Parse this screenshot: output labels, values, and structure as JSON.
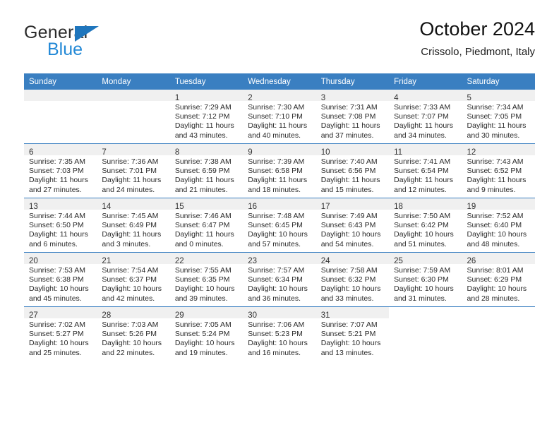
{
  "brand": {
    "name_top": "General",
    "name_bottom": "Blue",
    "accent_color": "#2288d6",
    "triangle_color": "#1f76bd"
  },
  "header": {
    "title": "October 2024",
    "subtitle": "Crissolo, Piedmont, Italy"
  },
  "theme": {
    "header_blue": "#3a7fc1",
    "daynum_band": "#f0f0f0",
    "text": "#2a2a2a"
  },
  "weekday_headers": [
    "Sunday",
    "Monday",
    "Tuesday",
    "Wednesday",
    "Thursday",
    "Friday",
    "Saturday"
  ],
  "labels": {
    "sunrise_prefix": "Sunrise:",
    "sunset_prefix": "Sunset:",
    "daylight_prefix": "Daylight:"
  },
  "weeks": [
    [
      {
        "day": "",
        "empty": true,
        "blank_band": false,
        "line1": "",
        "line2": "",
        "line3": "",
        "line4": ""
      },
      {
        "day": "",
        "empty": true,
        "blank_band": false,
        "line1": "",
        "line2": "",
        "line3": "",
        "line4": ""
      },
      {
        "day": "1",
        "line1": "Sunrise: 7:29 AM",
        "line2": "Sunset: 7:12 PM",
        "line3": "Daylight: 11 hours",
        "line4": "and 43 minutes."
      },
      {
        "day": "2",
        "line1": "Sunrise: 7:30 AM",
        "line2": "Sunset: 7:10 PM",
        "line3": "Daylight: 11 hours",
        "line4": "and 40 minutes."
      },
      {
        "day": "3",
        "line1": "Sunrise: 7:31 AM",
        "line2": "Sunset: 7:08 PM",
        "line3": "Daylight: 11 hours",
        "line4": "and 37 minutes."
      },
      {
        "day": "4",
        "line1": "Sunrise: 7:33 AM",
        "line2": "Sunset: 7:07 PM",
        "line3": "Daylight: 11 hours",
        "line4": "and 34 minutes."
      },
      {
        "day": "5",
        "line1": "Sunrise: 7:34 AM",
        "line2": "Sunset: 7:05 PM",
        "line3": "Daylight: 11 hours",
        "line4": "and 30 minutes."
      }
    ],
    [
      {
        "day": "6",
        "line1": "Sunrise: 7:35 AM",
        "line2": "Sunset: 7:03 PM",
        "line3": "Daylight: 11 hours",
        "line4": "and 27 minutes."
      },
      {
        "day": "7",
        "line1": "Sunrise: 7:36 AM",
        "line2": "Sunset: 7:01 PM",
        "line3": "Daylight: 11 hours",
        "line4": "and 24 minutes."
      },
      {
        "day": "8",
        "line1": "Sunrise: 7:38 AM",
        "line2": "Sunset: 6:59 PM",
        "line3": "Daylight: 11 hours",
        "line4": "and 21 minutes."
      },
      {
        "day": "9",
        "line1": "Sunrise: 7:39 AM",
        "line2": "Sunset: 6:58 PM",
        "line3": "Daylight: 11 hours",
        "line4": "and 18 minutes."
      },
      {
        "day": "10",
        "line1": "Sunrise: 7:40 AM",
        "line2": "Sunset: 6:56 PM",
        "line3": "Daylight: 11 hours",
        "line4": "and 15 minutes."
      },
      {
        "day": "11",
        "line1": "Sunrise: 7:41 AM",
        "line2": "Sunset: 6:54 PM",
        "line3": "Daylight: 11 hours",
        "line4": "and 12 minutes."
      },
      {
        "day": "12",
        "line1": "Sunrise: 7:43 AM",
        "line2": "Sunset: 6:52 PM",
        "line3": "Daylight: 11 hours",
        "line4": "and 9 minutes."
      }
    ],
    [
      {
        "day": "13",
        "line1": "Sunrise: 7:44 AM",
        "line2": "Sunset: 6:50 PM",
        "line3": "Daylight: 11 hours",
        "line4": "and 6 minutes."
      },
      {
        "day": "14",
        "line1": "Sunrise: 7:45 AM",
        "line2": "Sunset: 6:49 PM",
        "line3": "Daylight: 11 hours",
        "line4": "and 3 minutes."
      },
      {
        "day": "15",
        "line1": "Sunrise: 7:46 AM",
        "line2": "Sunset: 6:47 PM",
        "line3": "Daylight: 11 hours",
        "line4": "and 0 minutes."
      },
      {
        "day": "16",
        "line1": "Sunrise: 7:48 AM",
        "line2": "Sunset: 6:45 PM",
        "line3": "Daylight: 10 hours",
        "line4": "and 57 minutes."
      },
      {
        "day": "17",
        "line1": "Sunrise: 7:49 AM",
        "line2": "Sunset: 6:43 PM",
        "line3": "Daylight: 10 hours",
        "line4": "and 54 minutes."
      },
      {
        "day": "18",
        "line1": "Sunrise: 7:50 AM",
        "line2": "Sunset: 6:42 PM",
        "line3": "Daylight: 10 hours",
        "line4": "and 51 minutes."
      },
      {
        "day": "19",
        "line1": "Sunrise: 7:52 AM",
        "line2": "Sunset: 6:40 PM",
        "line3": "Daylight: 10 hours",
        "line4": "and 48 minutes."
      }
    ],
    [
      {
        "day": "20",
        "line1": "Sunrise: 7:53 AM",
        "line2": "Sunset: 6:38 PM",
        "line3": "Daylight: 10 hours",
        "line4": "and 45 minutes."
      },
      {
        "day": "21",
        "line1": "Sunrise: 7:54 AM",
        "line2": "Sunset: 6:37 PM",
        "line3": "Daylight: 10 hours",
        "line4": "and 42 minutes."
      },
      {
        "day": "22",
        "line1": "Sunrise: 7:55 AM",
        "line2": "Sunset: 6:35 PM",
        "line3": "Daylight: 10 hours",
        "line4": "and 39 minutes."
      },
      {
        "day": "23",
        "line1": "Sunrise: 7:57 AM",
        "line2": "Sunset: 6:34 PM",
        "line3": "Daylight: 10 hours",
        "line4": "and 36 minutes."
      },
      {
        "day": "24",
        "line1": "Sunrise: 7:58 AM",
        "line2": "Sunset: 6:32 PM",
        "line3": "Daylight: 10 hours",
        "line4": "and 33 minutes."
      },
      {
        "day": "25",
        "line1": "Sunrise: 7:59 AM",
        "line2": "Sunset: 6:30 PM",
        "line3": "Daylight: 10 hours",
        "line4": "and 31 minutes."
      },
      {
        "day": "26",
        "line1": "Sunrise: 8:01 AM",
        "line2": "Sunset: 6:29 PM",
        "line3": "Daylight: 10 hours",
        "line4": "and 28 minutes."
      }
    ],
    [
      {
        "day": "27",
        "line1": "Sunrise: 7:02 AM",
        "line2": "Sunset: 5:27 PM",
        "line3": "Daylight: 10 hours",
        "line4": "and 25 minutes."
      },
      {
        "day": "28",
        "line1": "Sunrise: 7:03 AM",
        "line2": "Sunset: 5:26 PM",
        "line3": "Daylight: 10 hours",
        "line4": "and 22 minutes."
      },
      {
        "day": "29",
        "line1": "Sunrise: 7:05 AM",
        "line2": "Sunset: 5:24 PM",
        "line3": "Daylight: 10 hours",
        "line4": "and 19 minutes."
      },
      {
        "day": "30",
        "line1": "Sunrise: 7:06 AM",
        "line2": "Sunset: 5:23 PM",
        "line3": "Daylight: 10 hours",
        "line4": "and 16 minutes."
      },
      {
        "day": "31",
        "line1": "Sunrise: 7:07 AM",
        "line2": "Sunset: 5:21 PM",
        "line3": "Daylight: 10 hours",
        "line4": "and 13 minutes."
      },
      {
        "day": "",
        "empty": true,
        "blank_band": true,
        "line1": "",
        "line2": "",
        "line3": "",
        "line4": ""
      },
      {
        "day": "",
        "empty": true,
        "blank_band": true,
        "line1": "",
        "line2": "",
        "line3": "",
        "line4": ""
      }
    ]
  ]
}
